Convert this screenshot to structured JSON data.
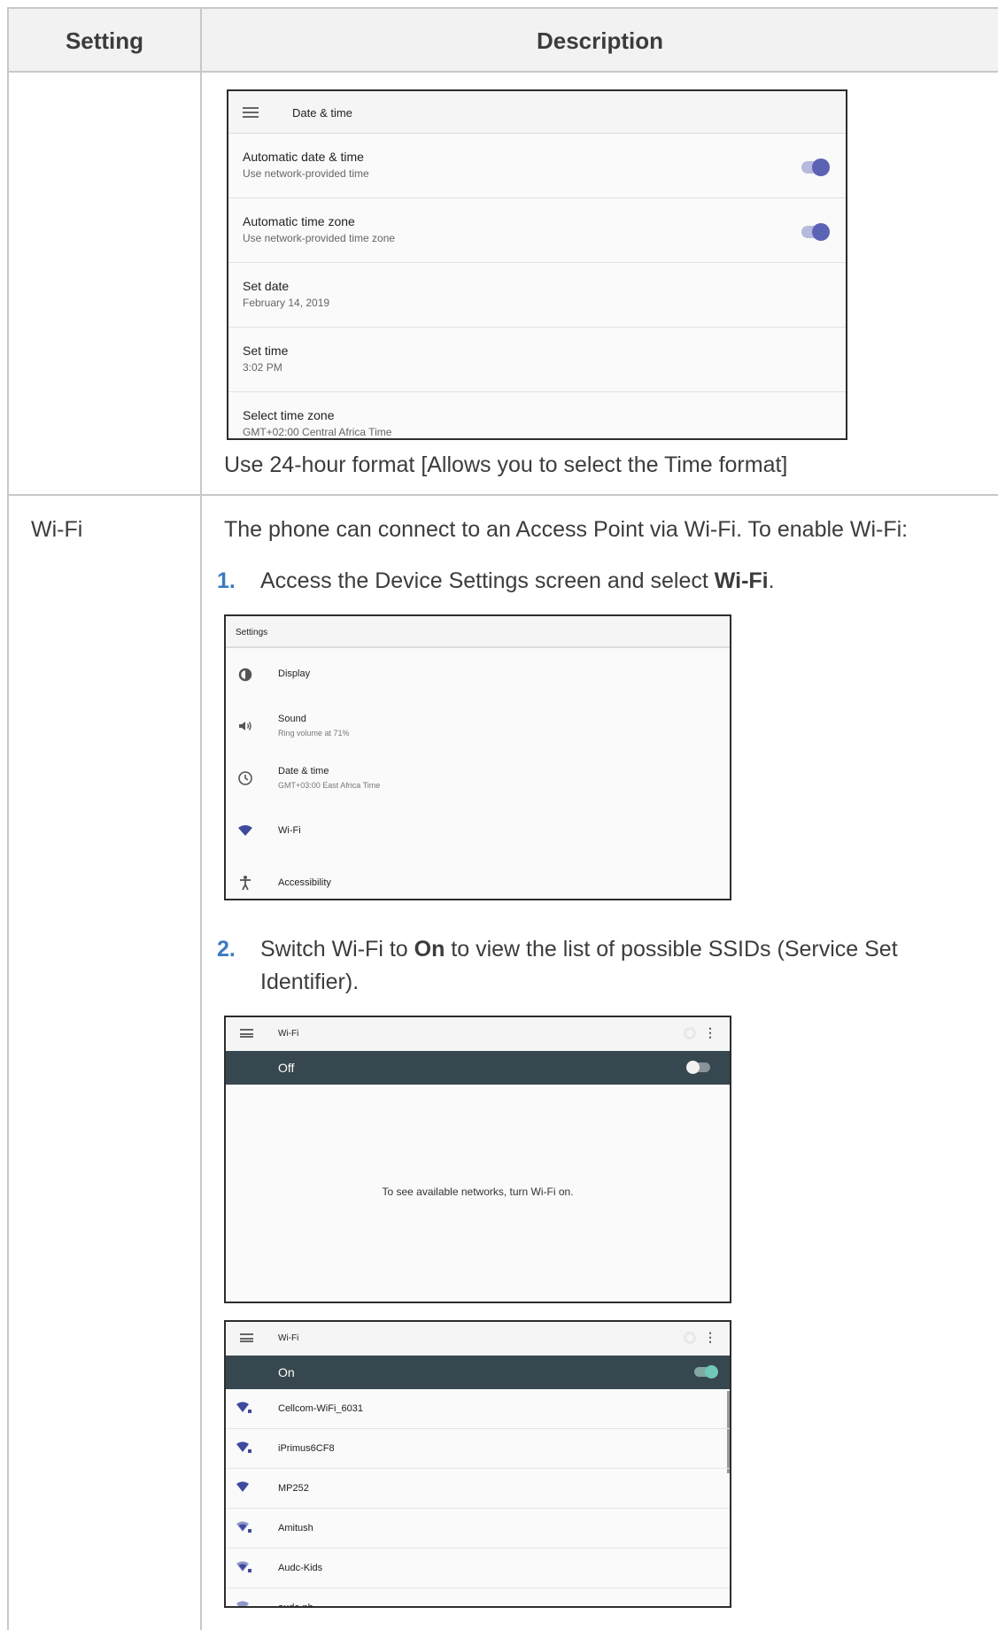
{
  "table": {
    "headers": {
      "setting": "Setting",
      "description": "Description"
    }
  },
  "row1": {
    "datetime_shot": {
      "title": "Date & time",
      "rows": [
        {
          "title": "Automatic date & time",
          "sub": "Use network-provided time",
          "toggle": true
        },
        {
          "title": "Automatic time zone",
          "sub": "Use network-provided time zone",
          "toggle": true
        },
        {
          "title": "Set date",
          "sub": "February 14, 2019",
          "toggle": false
        },
        {
          "title": "Set time",
          "sub": "3:02 PM",
          "toggle": false
        },
        {
          "title": "Select time zone",
          "sub": "GMT+02:00 Central Africa Time",
          "toggle": false
        }
      ],
      "accent": "#5c63b5"
    },
    "format_text": "Use 24-hour format [Allows you to select the Time format]"
  },
  "row2": {
    "setting": "Wi-Fi",
    "intro": "The phone can connect to an Access Point via Wi-Fi. To enable Wi-Fi:",
    "step1": {
      "number": "1.",
      "pre": "Access the Device Settings screen and select ",
      "bold": "Wi-Fi",
      "post": "."
    },
    "settings_shot": {
      "title": "Settings",
      "items": [
        {
          "label": "Display",
          "sub": "",
          "icon": "display-icon"
        },
        {
          "label": "Sound",
          "sub": "Ring volume at 71%",
          "icon": "volume-icon"
        },
        {
          "label": "Date & time",
          "sub": "GMT+03:00 East Africa Time",
          "icon": "clock-icon"
        },
        {
          "label": "Wi-Fi",
          "sub": "",
          "icon": "wifi-icon"
        },
        {
          "label": "Accessibility",
          "sub": "",
          "icon": "accessibility-icon"
        }
      ]
    },
    "step2": {
      "number": "2.",
      "pre": "Switch Wi-Fi to ",
      "bold": "On",
      "post": " to view the list of possible SSIDs (Service Set",
      "line2": "Identifier)."
    },
    "wifi_off_shot": {
      "title": "Wi-Fi",
      "state": "Off",
      "message": "To see available networks, turn Wi-Fi on."
    },
    "wifi_on_shot": {
      "title": "Wi-Fi",
      "state": "On",
      "networks": [
        "Cellcom-WiFi_6031",
        "iPrimus6CF8",
        "MP252",
        "Amitush",
        "Audc-Kids",
        "audc-ph"
      ],
      "accent": "#6fc8b8"
    }
  },
  "colors": {
    "step_number": "#3b7ac0",
    "header_bg": "#f2f2f2",
    "dark_strip": "#37474f",
    "wifi_icon": "#3f4a9e"
  }
}
